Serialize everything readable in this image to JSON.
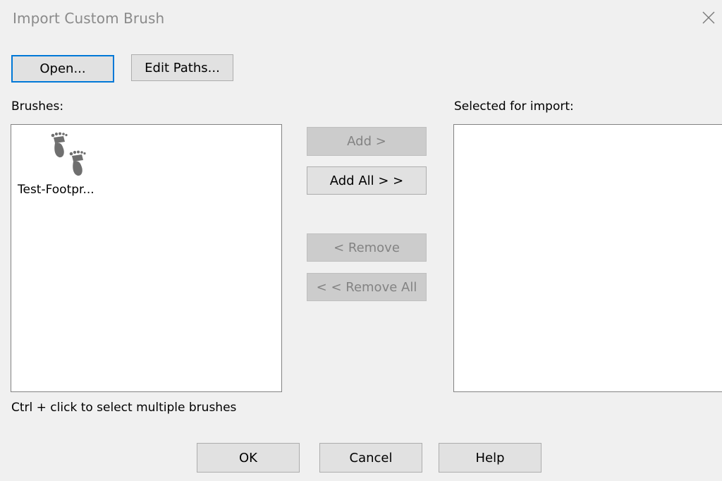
{
  "window": {
    "title": "Import Custom Brush",
    "close_icon": "close-icon"
  },
  "toolbar": {
    "open_label": "Open...",
    "edit_paths_label": "Edit Paths..."
  },
  "brushes_panel": {
    "label": "Brushes:",
    "items": [
      {
        "label": "Test-Footpr...",
        "icon": "footprints-icon"
      }
    ],
    "hint": "Ctrl + click to select multiple brushes"
  },
  "transfer_buttons": {
    "add_label": "Add >",
    "add_all_label": "Add All > >",
    "remove_label": "< Remove",
    "remove_all_label": "< < Remove All"
  },
  "selected_panel": {
    "label": "Selected for import:",
    "items": []
  },
  "footer": {
    "ok_label": "OK",
    "cancel_label": "Cancel",
    "help_label": "Help"
  },
  "colors": {
    "dialog_background": "#f0f0f0",
    "title_text": "#8a8a8a",
    "default_button_border": "#0078d7",
    "disabled_text": "#838383"
  }
}
